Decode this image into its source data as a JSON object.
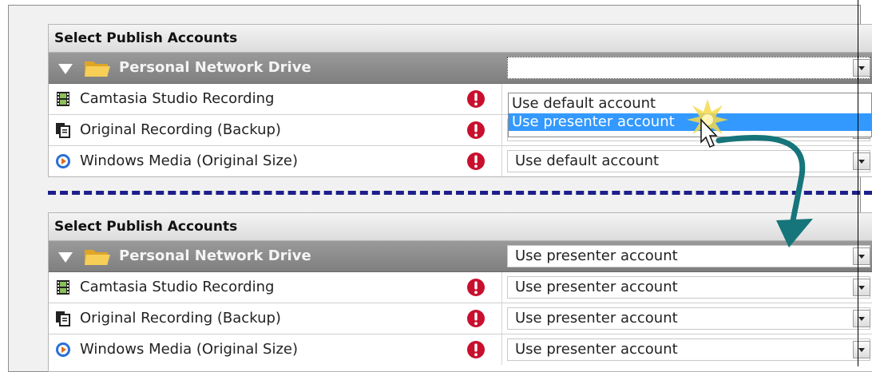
{
  "top_panel": {
    "header": "Select Publish Accounts",
    "group": {
      "title": "Personal Network Drive",
      "select_value": ""
    },
    "rows": [
      {
        "label": "Camtasia Studio Recording",
        "icon": "film-icon",
        "select_value": ""
      },
      {
        "label": "Original Recording (Backup)",
        "icon": "copy-documents-icon",
        "select_value": "Use default account"
      },
      {
        "label": "Windows Media (Original Size)",
        "icon": "windows-media-icon",
        "select_value": "Use default account"
      }
    ]
  },
  "dropdown": {
    "options": [
      "Use default account",
      "Use presenter account"
    ],
    "selected": "Use presenter account"
  },
  "bottom_panel": {
    "header": "Select Publish Accounts",
    "group": {
      "title": "Personal Network Drive",
      "select_value": "Use presenter account"
    },
    "rows": [
      {
        "label": "Camtasia Studio Recording",
        "icon": "film-icon",
        "select_value": "Use presenter account"
      },
      {
        "label": "Original Recording (Backup)",
        "icon": "copy-documents-icon",
        "select_value": "Use presenter account"
      },
      {
        "label": "Windows Media (Original Size)",
        "icon": "windows-media-icon",
        "select_value": "Use presenter account"
      }
    ]
  },
  "colors": {
    "group_header": "#8c8c8c",
    "selection": "#3399ff",
    "warning": "#c8102e",
    "dashed_separator": "#1c1f8a",
    "arrow": "#16757a"
  }
}
